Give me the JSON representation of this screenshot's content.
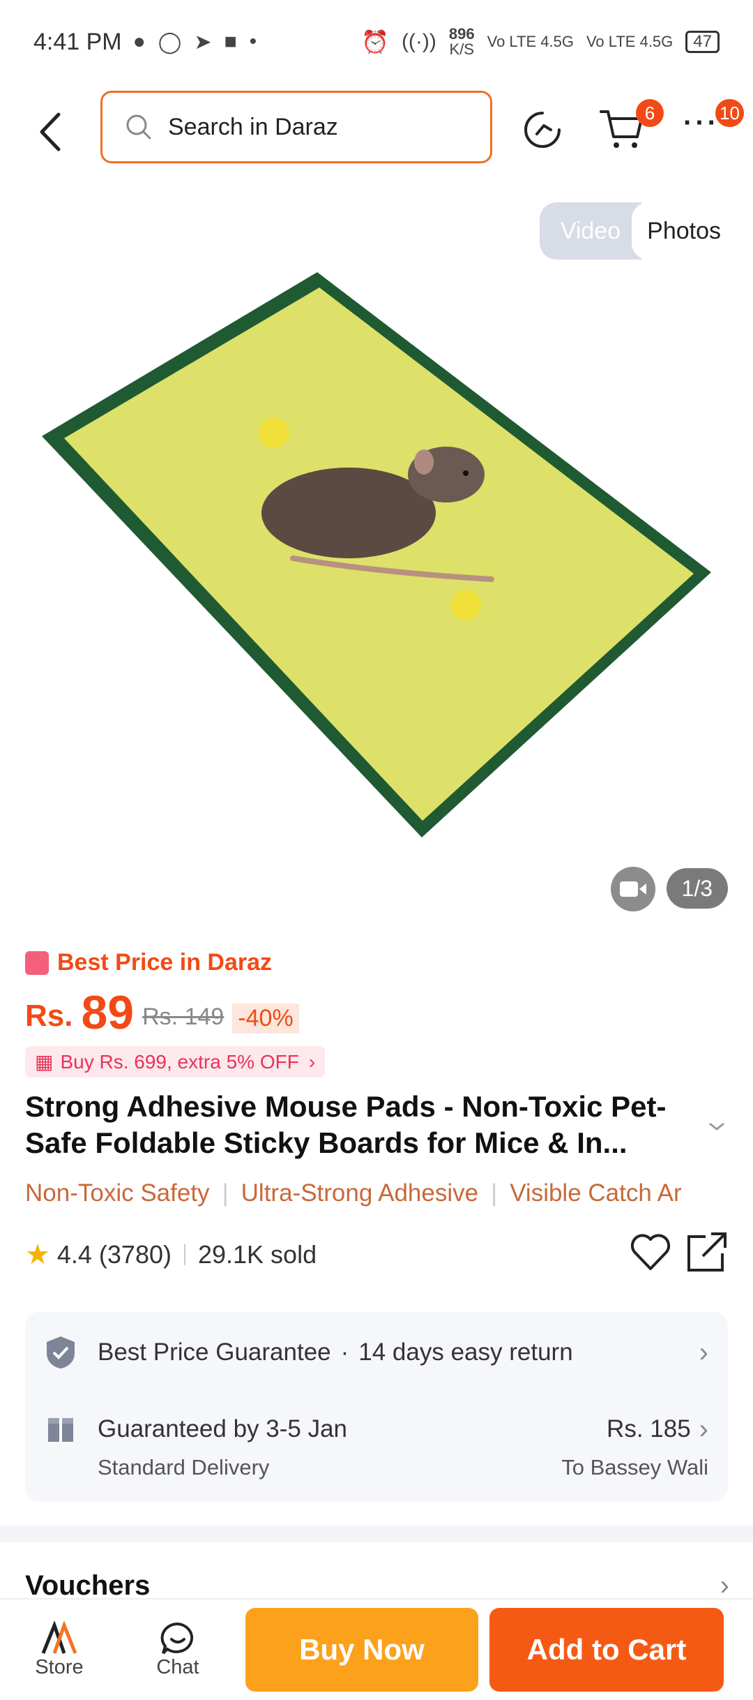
{
  "status_bar": {
    "time": "4:41 PM",
    "net_speed": "896",
    "net_unit": "K/S",
    "signal1": "Vo LTE 4.5G",
    "signal2": "Vo LTE 4.5G",
    "battery": "47"
  },
  "header": {
    "search_placeholder": "Search in Daraz",
    "cart_count": "6",
    "more_count": "10"
  },
  "gallery": {
    "tab_video": "Video",
    "tab_photos": "Photos",
    "counter": "1/3"
  },
  "product": {
    "best_price_label": "Best Price in Daraz",
    "currency": "Rs.",
    "price": "89",
    "old_price": "Rs. 149",
    "discount": "-40%",
    "promo": "Buy Rs. 699, extra 5% OFF",
    "title": "Strong Adhesive Mouse Pads - Non-Toxic Pet-Safe Foldable Sticky Boards for Mice & In...",
    "tags": [
      "Non-Toxic Safety",
      "Ultra-Strong Adhesive",
      "Visible Catch Ar"
    ],
    "rating": "4.4",
    "reviews": "(3780)",
    "sold": "29.1K sold"
  },
  "services": {
    "guarantee": "Best Price Guarantee",
    "return": "14 days easy return",
    "delivery_title": "Guaranteed by 3-5 Jan",
    "delivery_type": "Standard Delivery",
    "delivery_price": "Rs. 185",
    "delivery_to": "To Bassey Wali"
  },
  "vouchers": {
    "title": "Vouchers"
  },
  "bottom_bar": {
    "store": "Store",
    "chat": "Chat",
    "buy_now": "Buy Now",
    "add_to_cart": "Add to Cart"
  },
  "colors": {
    "accent": "#f24a16",
    "buy_now": "#fba11b",
    "add_to_cart": "#f55a14"
  }
}
